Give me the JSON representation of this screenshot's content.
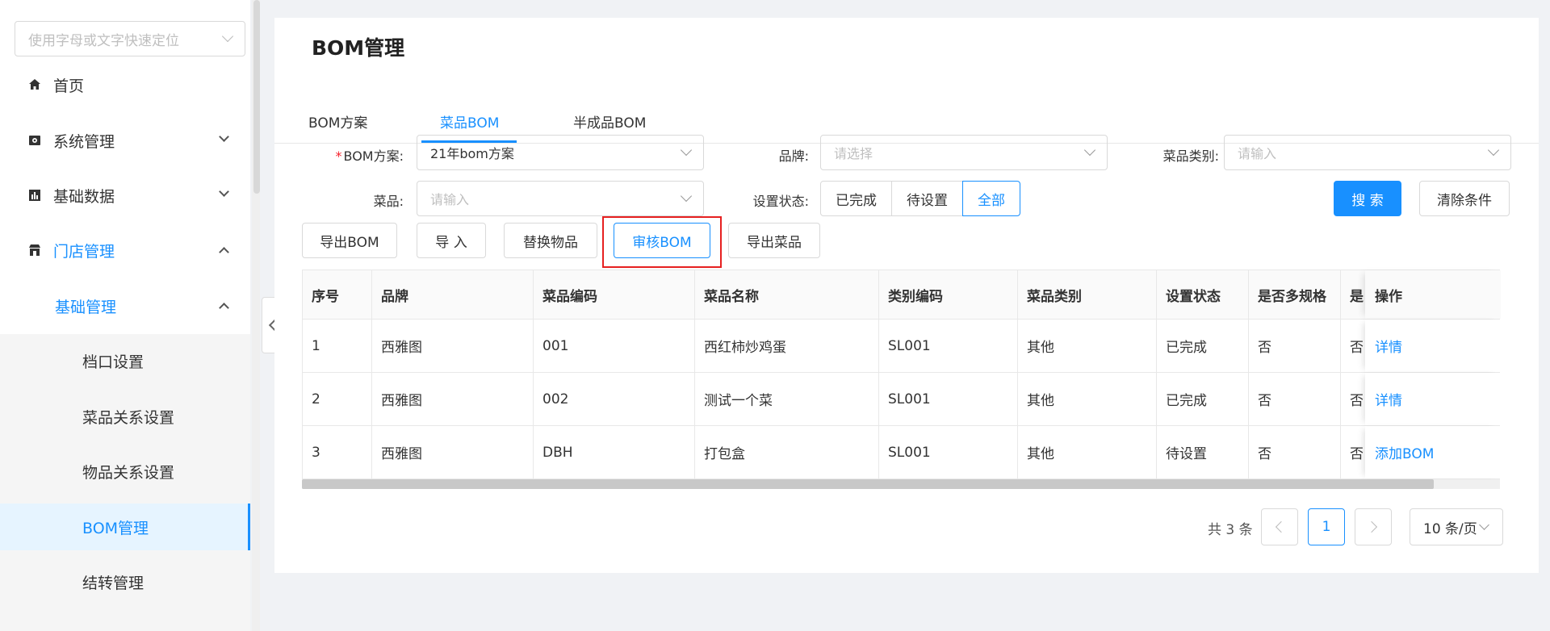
{
  "sidebar": {
    "search_placeholder": "使用字母或文字快速定位",
    "items": [
      {
        "label": "首页",
        "icon": "home-icon"
      },
      {
        "label": "系统管理",
        "icon": "settings-icon"
      },
      {
        "label": "基础数据",
        "icon": "chart-icon"
      },
      {
        "label": "门店管理",
        "icon": "store-icon"
      }
    ],
    "sub_group": "基础管理",
    "leaves": [
      "档口设置",
      "菜品关系设置",
      "物品关系设置",
      "BOM管理",
      "结转管理"
    ],
    "selected_leaf": "BOM管理"
  },
  "page": {
    "title": "BOM管理",
    "tabs": [
      "BOM方案",
      "菜品BOM",
      "半成品BOM"
    ],
    "active_tab": "菜品BOM"
  },
  "filters": {
    "scheme_label": "BOM方案:",
    "scheme_value": "21年bom方案",
    "brand_label": "品牌:",
    "brand_placeholder": "请选择",
    "category_label": "菜品类别:",
    "category_placeholder": "请输入",
    "dish_label": "菜品:",
    "dish_placeholder": "请输入",
    "status_label": "设置状态:",
    "status_options": [
      "已完成",
      "待设置",
      "全部"
    ],
    "status_selected": "全部",
    "search_button": "搜 索",
    "clear_button": "清除条件"
  },
  "toolbar": {
    "export_bom": "导出BOM",
    "import": "导 入",
    "replace_item": "替换物品",
    "review_bom": "审核BOM",
    "export_dish": "导出菜品"
  },
  "table": {
    "headers": [
      "序号",
      "品牌",
      "菜品编码",
      "菜品名称",
      "类别编码",
      "菜品类别",
      "设置状态",
      "是否多规格",
      "是",
      "操作"
    ],
    "rows": [
      {
        "no": "1",
        "brand": "西雅图",
        "code": "001",
        "name": "西红柿炒鸡蛋",
        "cat_code": "SL001",
        "category": "其他",
        "status": "已完成",
        "multi": "否",
        "extra": "否",
        "action": "详情"
      },
      {
        "no": "2",
        "brand": "西雅图",
        "code": "002",
        "name": "测试一个菜",
        "cat_code": "SL001",
        "category": "其他",
        "status": "已完成",
        "multi": "否",
        "extra": "否",
        "action": "详情"
      },
      {
        "no": "3",
        "brand": "西雅图",
        "code": "DBH",
        "name": "打包盒",
        "cat_code": "SL001",
        "category": "其他",
        "status": "待设置",
        "multi": "否",
        "extra": "否",
        "action": "添加BOM"
      }
    ]
  },
  "pagination": {
    "total_text": "共 3 条",
    "current_page": "1",
    "page_size": "10 条/页"
  },
  "colors": {
    "accent": "#1890ff",
    "highlight": "#e62020"
  }
}
